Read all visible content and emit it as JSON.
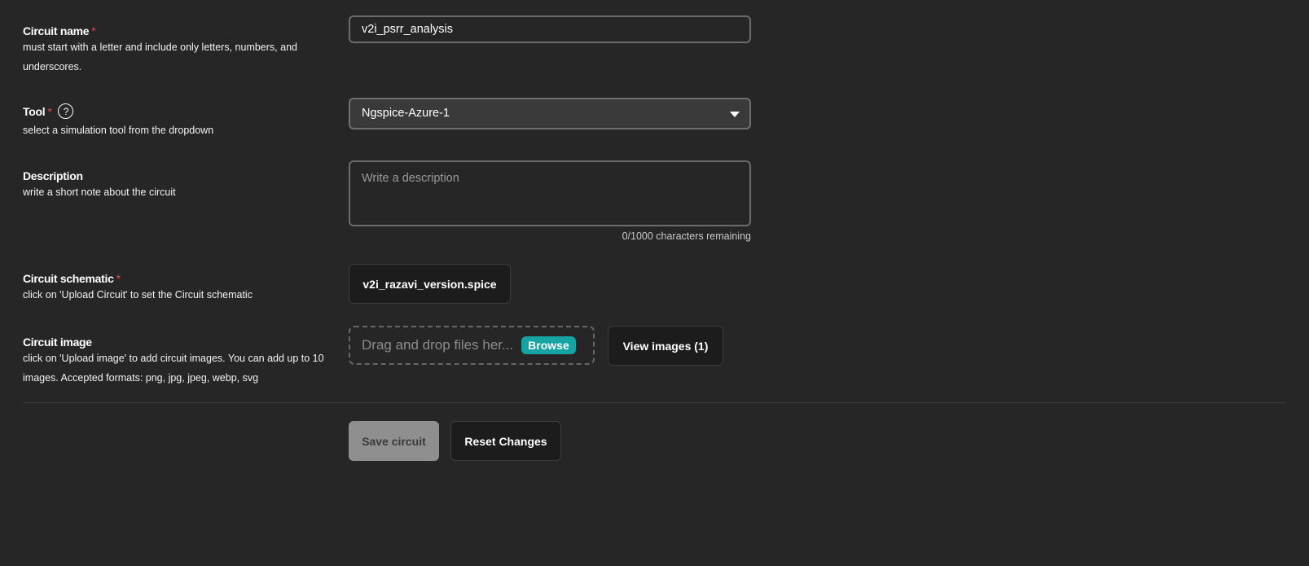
{
  "circuit_name": {
    "label": "Circuit name",
    "required": "*",
    "help": "must start with a letter and include only letters, numbers, and underscores.",
    "value": "v2i_psrr_analysis"
  },
  "tool": {
    "label": "Tool",
    "required": "*",
    "help_icon": "?",
    "help": "select a simulation tool from the dropdown",
    "selected": "Ngspice-Azure-1"
  },
  "description": {
    "label": "Description",
    "help": "write a short note about the circuit",
    "placeholder": "Write a description",
    "counter": "0/1000 characters remaining"
  },
  "schematic": {
    "label": "Circuit schematic",
    "required": "*",
    "help": "click on 'Upload Circuit' to set the Circuit schematic",
    "file": "v2i_razavi_version.spice"
  },
  "image": {
    "label": "Circuit image",
    "help": "click on 'Upload image' to add circuit images. You can add up to 10 images. Accepted formats: png, jpg, jpeg, webp, svg",
    "dropzone_text": "Drag and drop files her...",
    "browse_label": "Browse",
    "view_label": "View images (1)"
  },
  "actions": {
    "save_label": "Save circuit",
    "reset_label": "Reset Changes"
  },
  "colors": {
    "background": "#262626",
    "required": "#e5484d",
    "browse": "#15a3a3",
    "save_disabled": "#8f8f8f"
  }
}
